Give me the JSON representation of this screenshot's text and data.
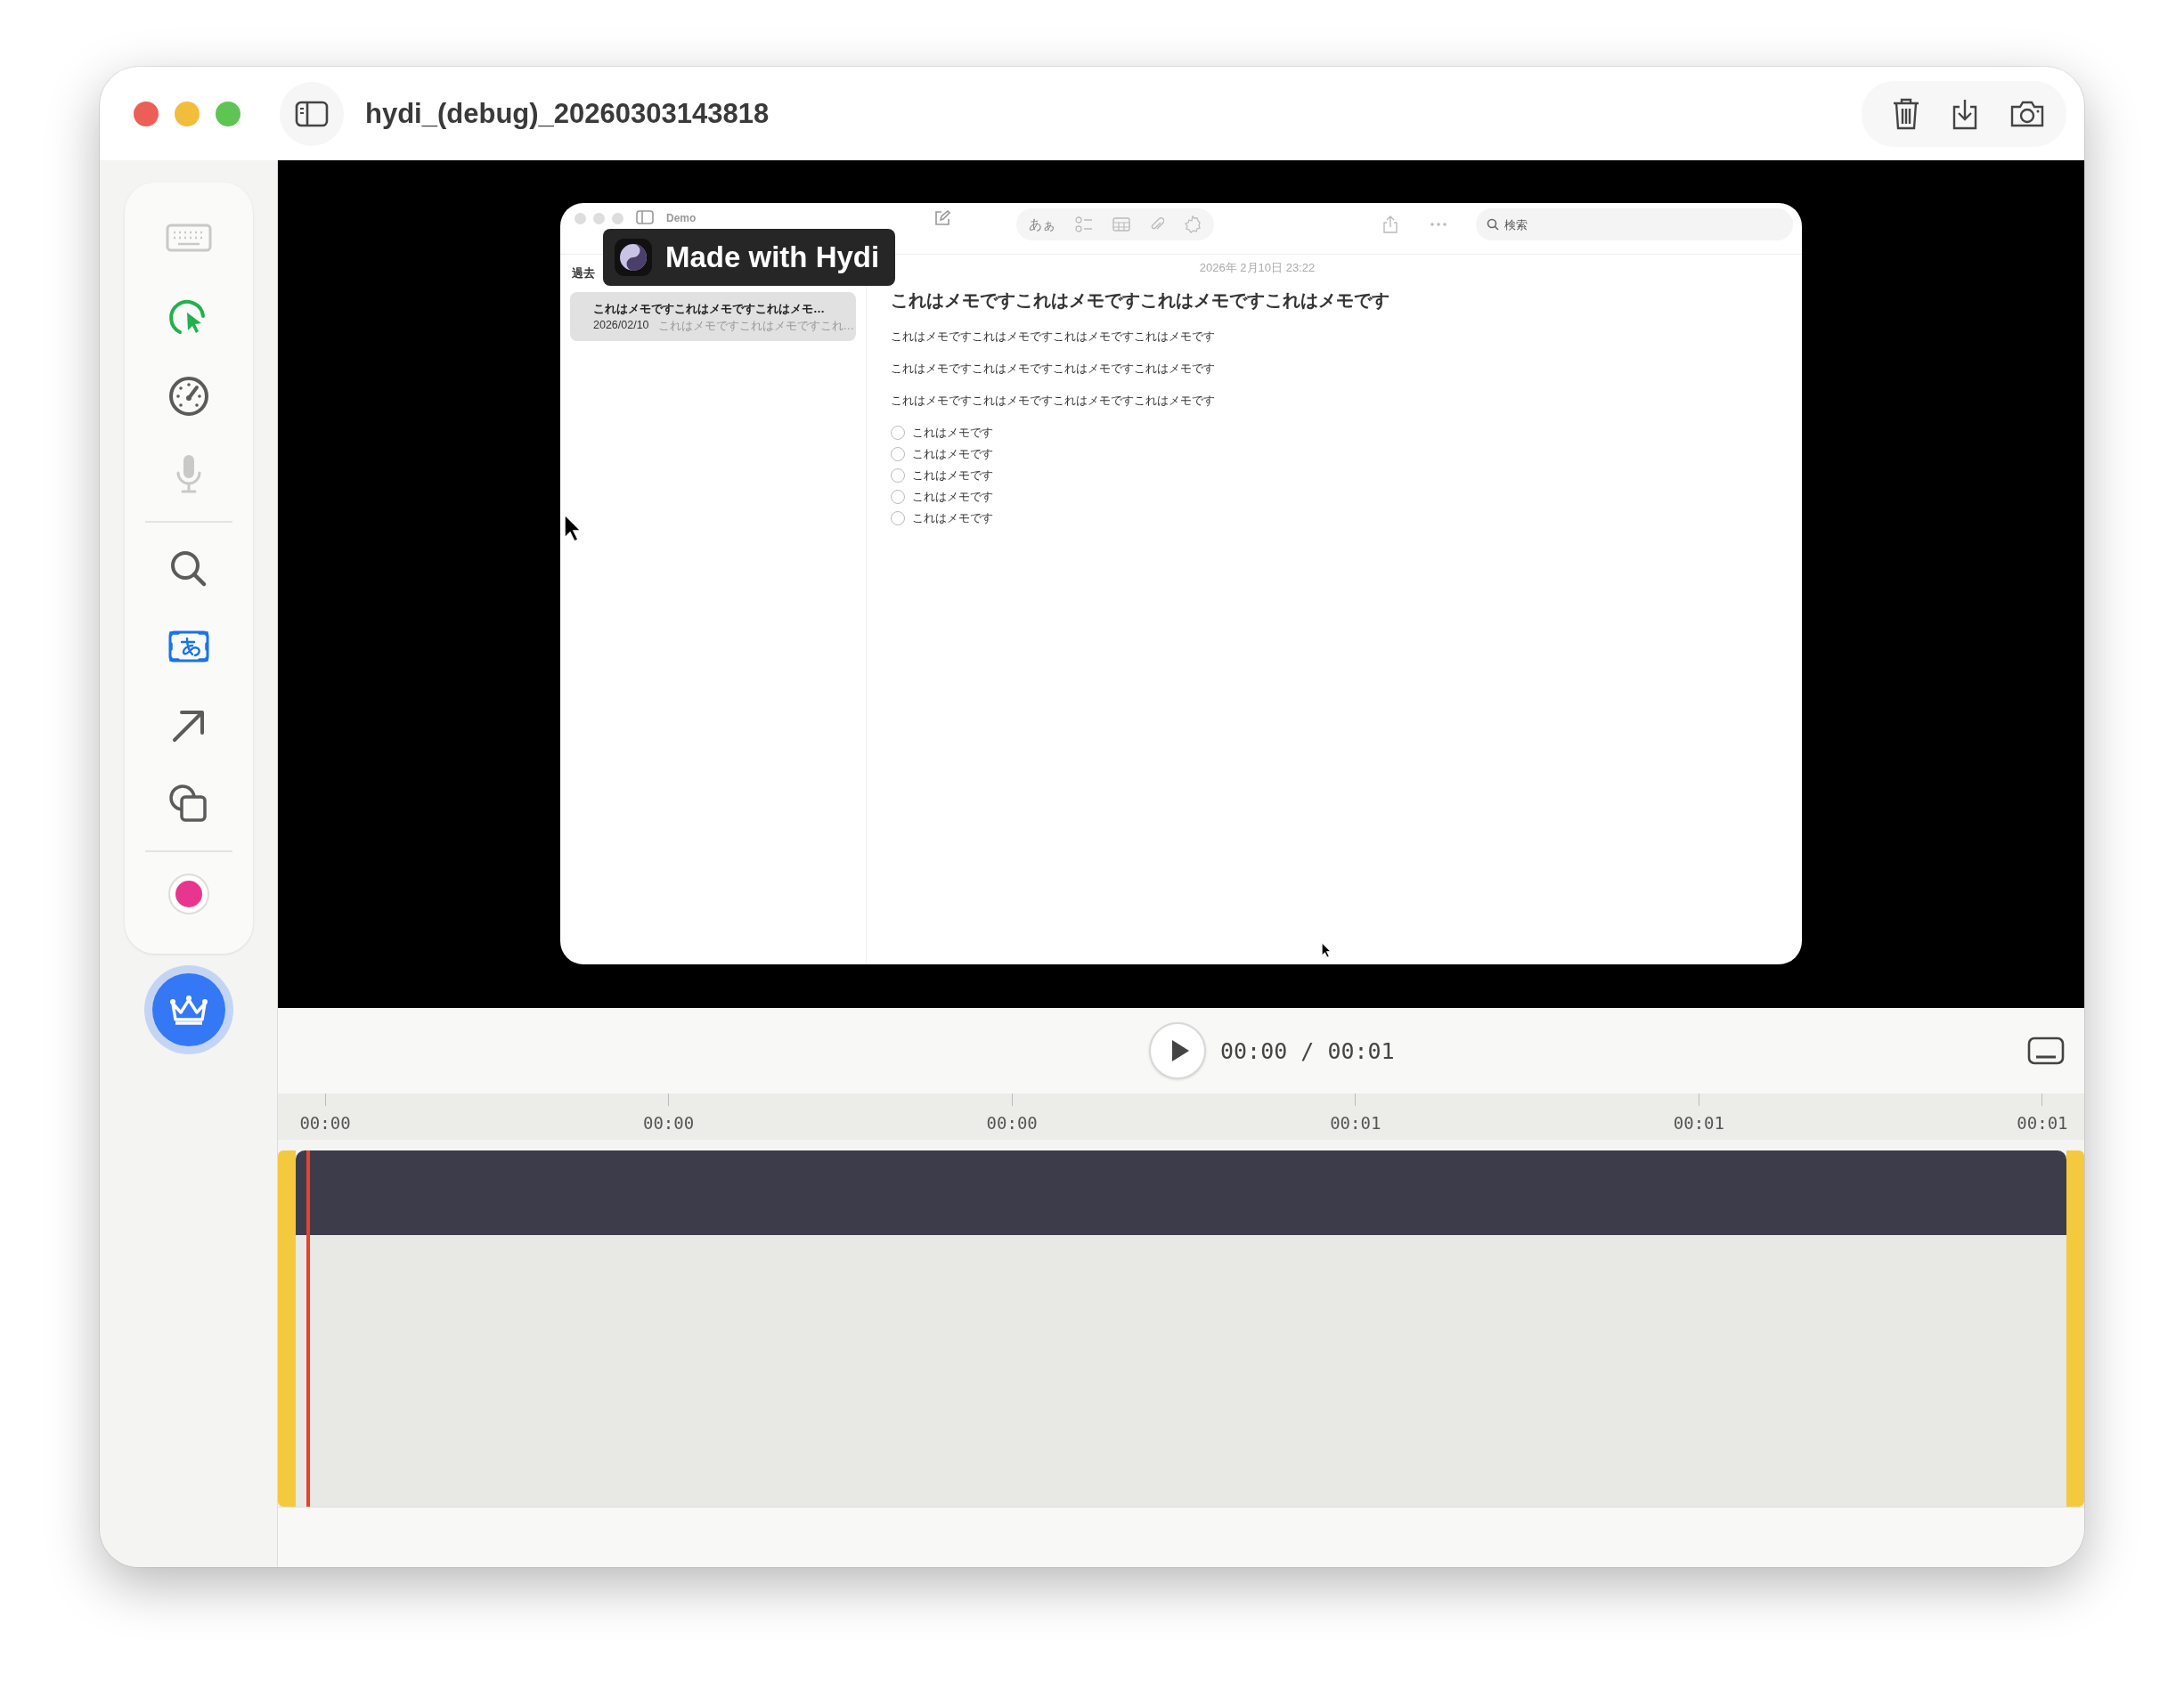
{
  "window": {
    "title": "hydi_(debug)_20260303143818"
  },
  "tools": [
    {
      "kind": "keyboard",
      "selected": false,
      "disabled": true
    },
    {
      "kind": "cursor",
      "selected": true,
      "disabled": false
    },
    {
      "kind": "speed",
      "selected": false,
      "disabled": false
    },
    {
      "kind": "mic",
      "selected": false,
      "disabled": true
    },
    {
      "kind": "divider"
    },
    {
      "kind": "zoom",
      "selected": false,
      "disabled": false
    },
    {
      "kind": "text",
      "selected": true,
      "disabled": false
    },
    {
      "kind": "arrow",
      "selected": false,
      "disabled": false
    },
    {
      "kind": "shapes",
      "selected": false,
      "disabled": false
    },
    {
      "kind": "divider"
    },
    {
      "kind": "swatch",
      "color": "#e8368f"
    }
  ],
  "video": {
    "watermark": "Made with Hydi",
    "notes": {
      "folder": "Demo",
      "list_header": "過去",
      "format_label": "あぁ",
      "search": {
        "placeholder": "検索"
      },
      "list": [
        {
          "title": "これはメモですこれはメモですこれはメモ…",
          "date": "2026/02/10",
          "preview": "これはメモですこれはメモですこれ…",
          "selected": true
        }
      ],
      "date": "2026年 2月10日 23:22",
      "heading": "これはメモですこれはメモですこれはメモですこれはメモです",
      "paragraphs": [
        "これはメモですこれはメモですこれはメモですこれはメモです",
        "これはメモですこれはメモですこれはメモですこれはメモです",
        "これはメモですこれはメモですこれはメモですこれはメモです"
      ],
      "checklist": [
        {
          "text": "これはメモです",
          "checked": false
        },
        {
          "text": "これはメモです",
          "checked": false
        },
        {
          "text": "これはメモです",
          "checked": false
        },
        {
          "text": "これはメモです",
          "checked": false
        },
        {
          "text": "これはメモです",
          "checked": false
        }
      ]
    }
  },
  "player": {
    "time": "00:00 / 00:01"
  },
  "ruler": [
    "00:00",
    "00:00",
    "00:00",
    "00:01",
    "00:01",
    "00:01"
  ],
  "timeline": {
    "level": 0.006
  }
}
